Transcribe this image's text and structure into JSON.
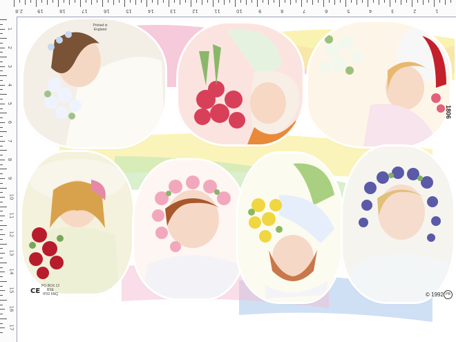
{
  "ruler": {
    "top_labels": [
      "2.8",
      "19",
      "18",
      "17",
      "16",
      "15",
      "14",
      "13",
      "12",
      "11",
      "10",
      "9",
      "8",
      "7",
      "6",
      "5",
      "4",
      "3",
      "2",
      "1"
    ],
    "left_labels": [
      "1",
      "2",
      "3",
      "4",
      "5",
      "6",
      "7",
      "8",
      "9",
      "10",
      "11",
      "12",
      "13",
      "14",
      "15",
      "16",
      "17"
    ]
  },
  "sheet": {
    "printed_note": "Printed in England",
    "side_code": "1806",
    "ce_mark": "CE",
    "address_lines": [
      "PO BOX 12",
      "BSE",
      "IP32 6NQ"
    ],
    "copyright": "© 1992",
    "logo_text": "PB"
  },
  "colors": {
    "ribbon_pink": "#f4bcd2",
    "ribbon_yellow": "#f9ef9c",
    "ribbon_green": "#c9e8b8",
    "ribbon_blue": "#bcd3ef"
  },
  "scraps": [
    {
      "subject": "girl-flower-crown-profile"
    },
    {
      "subject": "girl-bonnet-red-roses"
    },
    {
      "subject": "girl-white-hat-bouquet"
    },
    {
      "subject": "girl-hat-red-roses"
    },
    {
      "subject": "girl-pink-flower-wreath"
    },
    {
      "subject": "girl-yellow-flowers-upside-down"
    },
    {
      "subject": "girl-blue-grapes-wreath"
    }
  ]
}
